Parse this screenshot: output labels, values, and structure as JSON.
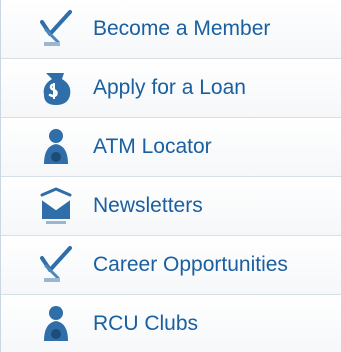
{
  "menu": {
    "items": [
      {
        "label": "Become a Member",
        "icon": "pencil-check-icon"
      },
      {
        "label": "Apply for a Loan",
        "icon": "money-bag-icon"
      },
      {
        "label": "ATM Locator",
        "icon": "person-icon"
      },
      {
        "label": "Newsletters",
        "icon": "mail-icon"
      },
      {
        "label": "Career Opportunities",
        "icon": "pencil-check-icon"
      },
      {
        "label": "RCU Clubs",
        "icon": "person-icon"
      }
    ]
  },
  "colors": {
    "link_text": "#1a5fa0",
    "icon_blue": "#2f6ea8",
    "divider": "#d6dee6"
  }
}
